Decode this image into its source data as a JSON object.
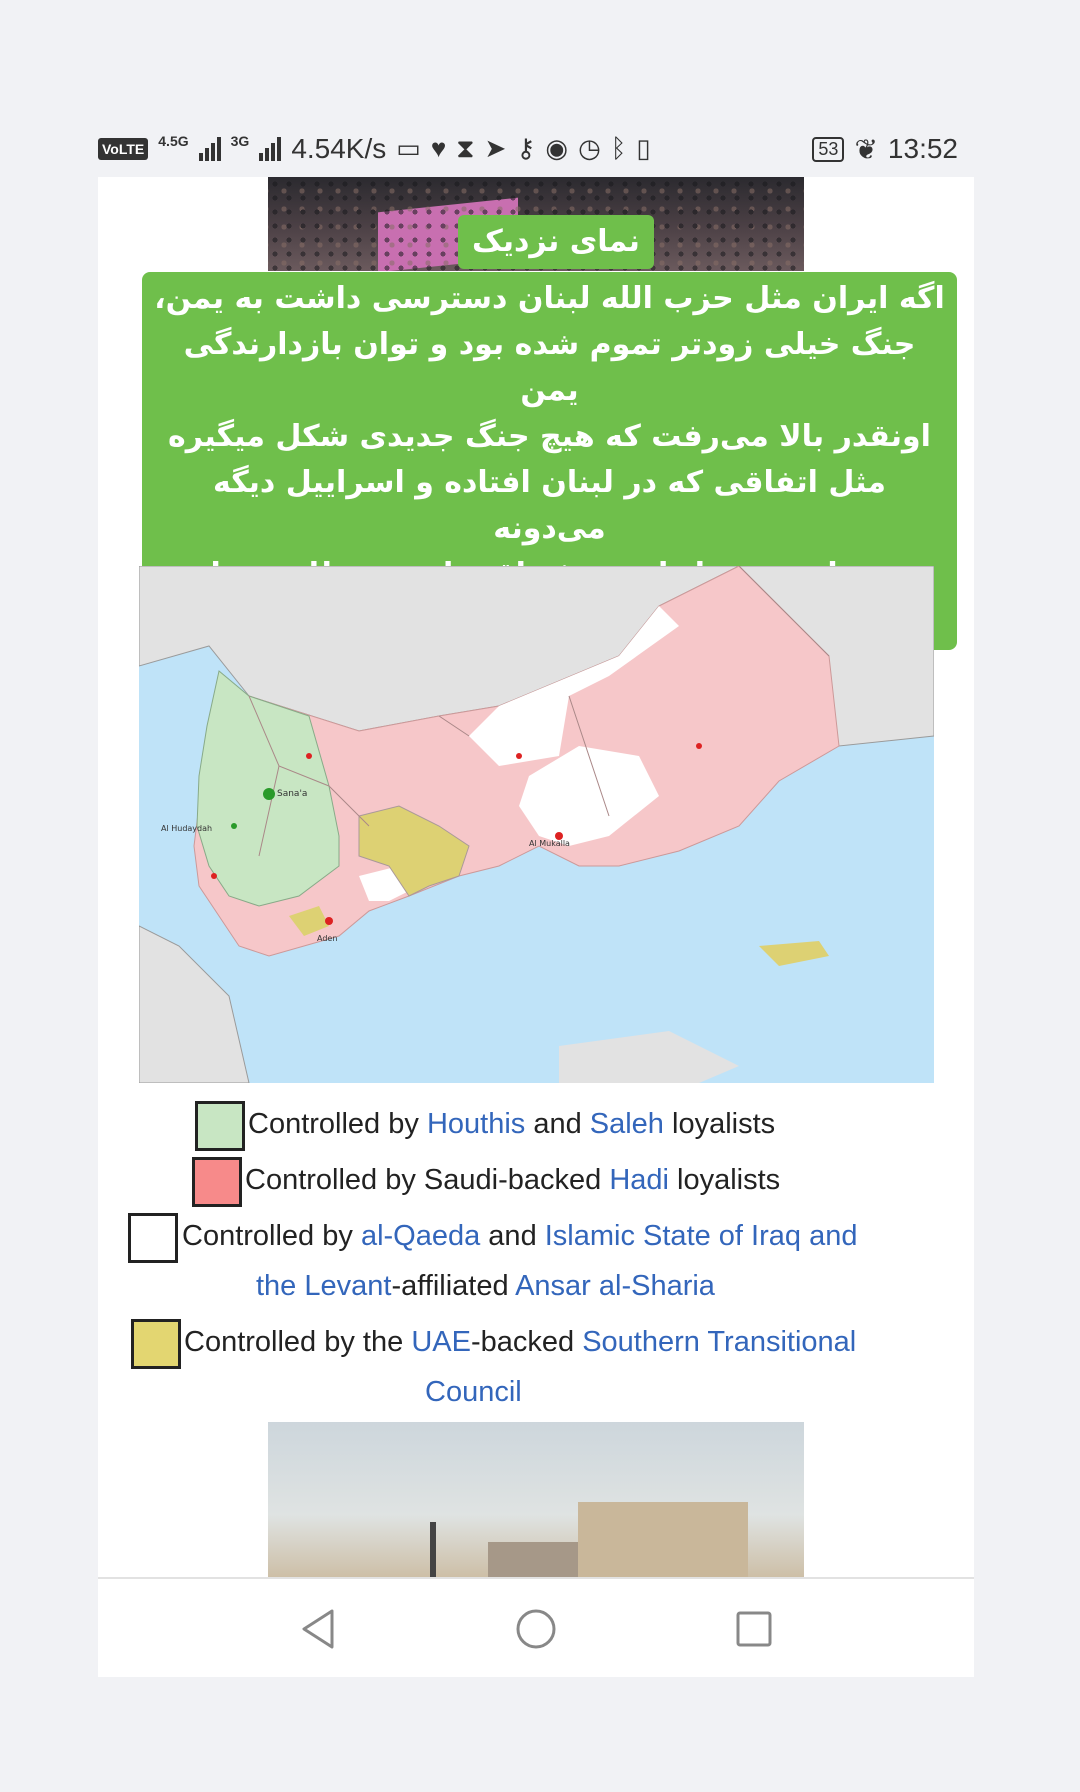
{
  "status_bar": {
    "volte": "VoLTE",
    "net1": "4.5G",
    "net2": "3G",
    "speed": "4.54K/s",
    "battery": "53",
    "time": "13:52",
    "icons": [
      "hd-icon",
      "heart-icon",
      "hourglass-icon",
      "telegram-icon",
      "key-icon",
      "eye-icon",
      "alarm-icon",
      "bluetooth-icon",
      "vibrate-icon",
      "battery-icon",
      "leaf-icon"
    ]
  },
  "caption": {
    "title": "نمای نزدیک",
    "lines": [
      "اگه ایران مثل حزب الله لبنان دسترسی داشت به یمن،",
      "جنگ خیلی زودتر تموم شده بود و توان بازدارندگی یمن",
      "اونقدر بالا می‌رفت که هیچ جنگ جدیدی شکل میگیره",
      "مثل اتفاقی که در لبنان افتاده و اسراییل دیگه می‌دونه",
      "هیچ تهاجمی به لبنان صرفه اقتصادی و نظامی نداره."
    ]
  },
  "map": {
    "labels": [
      "Sana'a",
      "Al Hudaydah",
      "Aden",
      "Al Mukalla"
    ],
    "colors": {
      "houthi": "#c8e6c3",
      "hadi": "#f6c7c9",
      "aqap": "#ffffff",
      "stc": "#ddd173",
      "sea": "#bfe3f8",
      "land": "#e2e2e2"
    }
  },
  "legend": {
    "row1": {
      "pre": "Controlled by ",
      "link1": "Houthis",
      "mid": " and ",
      "link2": "Saleh",
      "post": " loyalists"
    },
    "row2": {
      "pre": "Controlled by Saudi-backed ",
      "link1": "Hadi",
      "post": " loyalists"
    },
    "row3": {
      "pre": "Controlled by ",
      "link1": "al-Qaeda",
      "mid": " and ",
      "link2a": "Islamic State of Iraq and",
      "link2b": "the Levant",
      "mid2": "-affiliated ",
      "link3": "Ansar al-Sharia"
    },
    "row4": {
      "pre": "Controlled by the ",
      "link1": "UAE",
      "mid": "-backed ",
      "link2a": "Southern Transitional",
      "link2b": "Council"
    },
    "swatch_colors": [
      "#c8e6c3",
      "#f78a8a",
      "#ffffff",
      "#e3d671"
    ]
  },
  "nav": {
    "back": "back",
    "home": "home",
    "recents": "recents"
  }
}
